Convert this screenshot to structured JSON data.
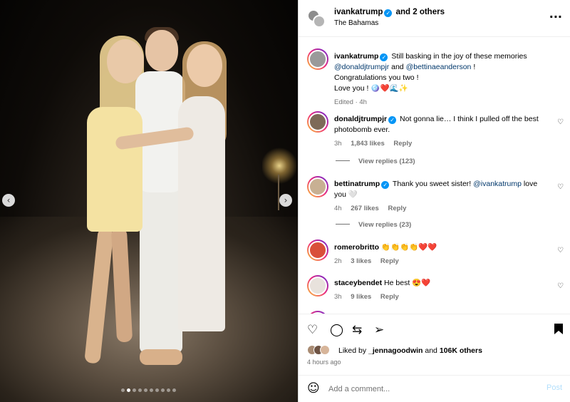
{
  "photo": {
    "prev_icon": "‹",
    "next_icon": "›",
    "dots_count": 10,
    "active_dot": 1
  },
  "header": {
    "username": "ivankatrump",
    "and_others": "and 2 others",
    "location": "The Bahamas",
    "verified_icon": "✓",
    "more_icon": "···"
  },
  "caption": {
    "username": "ivankatrump",
    "text_before": "Still basking in the joy of these memories",
    "mention1": "@donaldjtrumpjr",
    "and_text": "and",
    "mention2": "@bettinaeanderson",
    "bang": "!",
    "line2": "Congratulations you two !",
    "line3": "Love you ! 🪩❤️🌊✨",
    "meta": "Edited · 4h"
  },
  "comments": [
    {
      "username": "donaldjtrumpjr",
      "text": "Not gonna lie… I think I pulled off the best photobomb ever.",
      "time": "3h",
      "likes": "1,843 likes",
      "reply": "Reply",
      "view_replies": "View replies (123)"
    },
    {
      "username": "bettinatrump",
      "text": "Thank you sweet sister!",
      "mention": "@ivankatrump",
      "text_after": "love you 🤍",
      "time": "4h",
      "likes": "267 likes",
      "reply": "Reply",
      "view_replies": "View replies (23)"
    },
    {
      "username": "romerobritto",
      "text": "👏👏👏👏❤️❤️",
      "time": "2h",
      "likes": "3 likes",
      "reply": "Reply"
    },
    {
      "username": "staceybendet",
      "text": "He best 😍❤️",
      "time": "3h",
      "likes": "9 likes",
      "reply": "Reply"
    }
  ],
  "actions": {
    "heart_icon": "♡",
    "comment_icon": "◯",
    "share_icon": "⇆",
    "send_icon": "➢",
    "bookmark_icon": "🔖",
    "liked_prefix": "Liked by",
    "liked_user": "_jennagoodwin",
    "liked_and": "and",
    "liked_others": "106K others",
    "time_ago": "4 hours ago"
  },
  "add_comment": {
    "emoji_icon": "☺",
    "placeholder": "Add a comment...",
    "post_label": "Post"
  },
  "icons": {
    "small_heart": "♡"
  },
  "colors": {
    "accent": "#0095f6",
    "mention": "#00376b",
    "muted": "#737373",
    "post_disabled": "#b2dffc"
  }
}
